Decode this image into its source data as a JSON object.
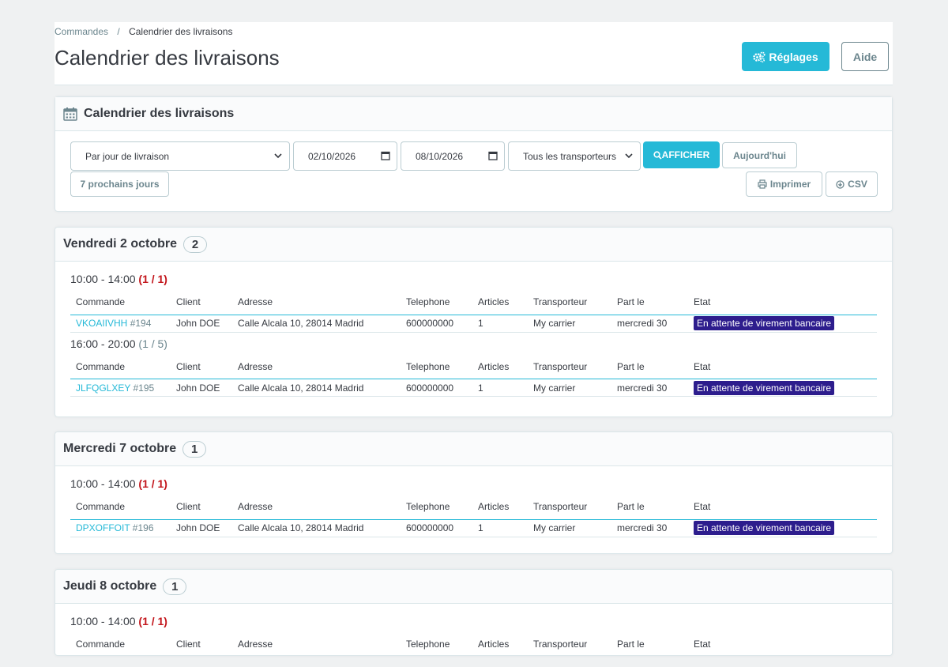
{
  "breadcrumb": {
    "parent": "Commandes",
    "separator": "/",
    "current": "Calendrier des livraisons"
  },
  "page_title": "Calendrier des livraisons",
  "toolbar": {
    "settings_label": "Réglages",
    "help_label": "Aide"
  },
  "filters_card": {
    "title": "Calendrier des livraisons",
    "mode_select": "Par jour de livraison",
    "date_from": "02/10/2026",
    "date_to": "08/10/2026",
    "carrier_select": "Tous les transporteurs",
    "show_label": "AFFICHER",
    "today_label": "Aujourd'hui",
    "next7_label": "7 prochains jours",
    "print_label": "Imprimer",
    "csv_label": "CSV"
  },
  "columns": [
    "Commande",
    "Client",
    "Adresse",
    "Telephone",
    "Articles",
    "Transporteur",
    "Part le",
    "Etat"
  ],
  "days": [
    {
      "title": "Vendredi 2 octobre",
      "count": "2",
      "slots": [
        {
          "time": "10:00 - 14:00",
          "count": "(1 / 1)",
          "full": true,
          "rows": [
            {
              "ref": "VKOAIIVHH",
              "num": "#194",
              "client": "John DOE",
              "address": "Calle Alcala 10, 28014 Madrid",
              "phone": "600000000",
              "articles": "1",
              "carrier": "My carrier",
              "ship": "mercredi 30",
              "state": "En attente de virement bancaire"
            }
          ]
        },
        {
          "time": "16:00 - 20:00",
          "count": "(1 / 5)",
          "full": false,
          "rows": [
            {
              "ref": "JLFQGLXEY",
              "num": "#195",
              "client": "John DOE",
              "address": "Calle Alcala 10, 28014 Madrid",
              "phone": "600000000",
              "articles": "1",
              "carrier": "My carrier",
              "ship": "mercredi 30",
              "state": "En attente de virement bancaire"
            }
          ]
        }
      ]
    },
    {
      "title": "Mercredi 7 octobre",
      "count": "1",
      "slots": [
        {
          "time": "10:00 - 14:00",
          "count": "(1 / 1)",
          "full": true,
          "rows": [
            {
              "ref": "DPXOFFOIT",
              "num": "#196",
              "client": "John DOE",
              "address": "Calle Alcala 10, 28014 Madrid",
              "phone": "600000000",
              "articles": "1",
              "carrier": "My carrier",
              "ship": "mercredi 30",
              "state": "En attente de virement bancaire"
            }
          ]
        }
      ]
    },
    {
      "title": "Jeudi 8 octobre",
      "count": "1",
      "slots": [
        {
          "time": "10:00 - 14:00",
          "count": "(1 / 1)",
          "full": true,
          "rows": []
        }
      ]
    }
  ],
  "colors": {
    "accent": "#25b9d7",
    "state_bg": "#2d1d8d",
    "slot_full": "#c3161c"
  }
}
